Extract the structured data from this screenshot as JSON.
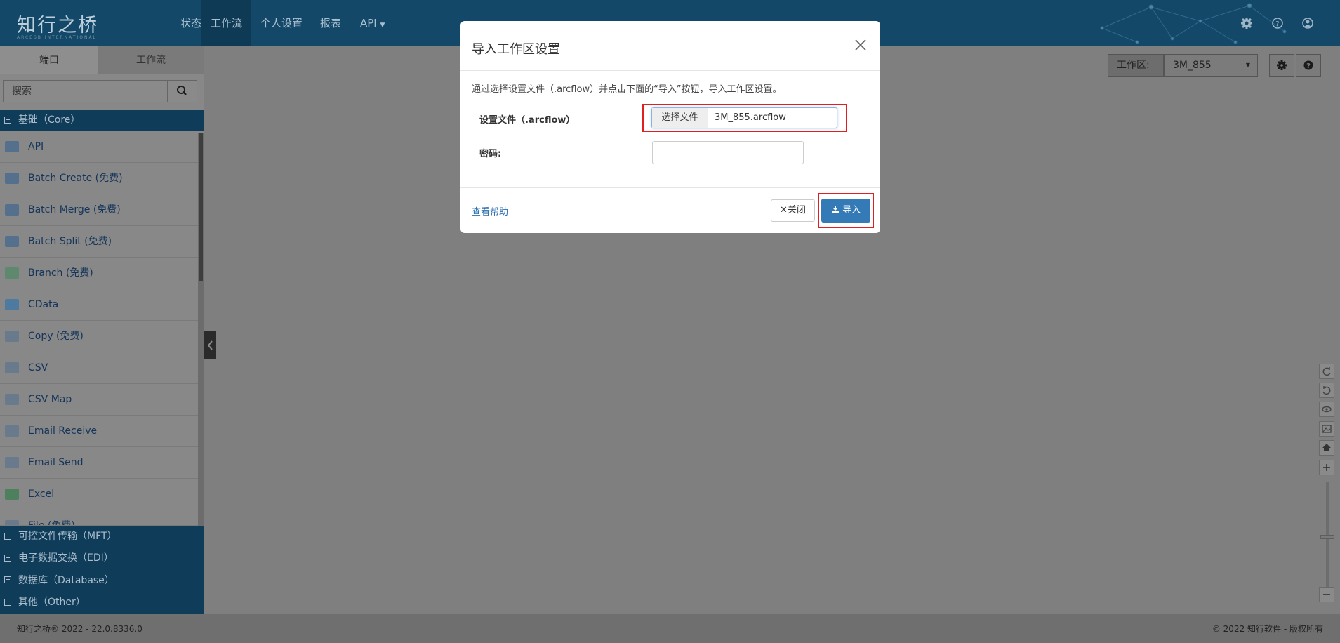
{
  "header": {
    "logo": "知行之桥",
    "logo_sub": "ARCESB INTERNATIONAL",
    "nav": [
      {
        "label": "状态"
      },
      {
        "label": "工作流"
      },
      {
        "label": "个人设置"
      },
      {
        "label": "报表"
      },
      {
        "label": "API"
      }
    ]
  },
  "sidebar": {
    "tabs": [
      {
        "label": "端口"
      },
      {
        "label": "工作流"
      }
    ],
    "search_placeholder": "搜索",
    "core_category": "基础（Core）",
    "ports": [
      {
        "label": "API",
        "icon": "api-gear-icon"
      },
      {
        "label": "Batch Create (免费)",
        "icon": "batch-create-icon"
      },
      {
        "label": "Batch Merge (免费)",
        "icon": "batch-merge-icon"
      },
      {
        "label": "Batch Split (免费)",
        "icon": "batch-split-icon"
      },
      {
        "label": "Branch (免费)",
        "icon": "branch-icon"
      },
      {
        "label": "CData",
        "icon": "cdata-icon"
      },
      {
        "label": "Copy (免费)",
        "icon": "copy-icon"
      },
      {
        "label": "CSV",
        "icon": "csv-icon"
      },
      {
        "label": "CSV Map",
        "icon": "csv-map-icon"
      },
      {
        "label": "Email Receive",
        "icon": "email-receive-icon"
      },
      {
        "label": "Email Send",
        "icon": "email-send-icon"
      },
      {
        "label": "Excel",
        "icon": "excel-icon"
      },
      {
        "label": "File (免费)",
        "icon": "file-icon"
      }
    ],
    "categories": [
      {
        "label": "可控文件传输（MFT）"
      },
      {
        "label": "电子数据交换（EDI）"
      },
      {
        "label": "数据库（Database）"
      },
      {
        "label": "其他（Other）"
      }
    ]
  },
  "workspace": {
    "label": "工作区:",
    "value": "3M_855"
  },
  "modal": {
    "title": "导入工作区设置",
    "description": "通过选择设置文件（.arcflow）并点击下面的“导入”按钮，导入工作区设置。",
    "file_label": "设置文件（.arcflow）",
    "choose_file": "选择文件",
    "file_name": "3M_855.arcflow",
    "password_label": "密码:",
    "password_value": "",
    "help_link": "查看帮助",
    "close_button": "关闭",
    "import_button": "导入"
  },
  "footer": {
    "left": "知行之桥® 2022 - 22.0.8336.0",
    "right": "© 2022 知行软件 - 版权所有"
  },
  "colors": {
    "header_bg": "#144869",
    "category_bg": "#0f3c59",
    "primary_button": "#337ab7",
    "highlight_border": "#e02020",
    "overlay": "#7f7f7f"
  }
}
